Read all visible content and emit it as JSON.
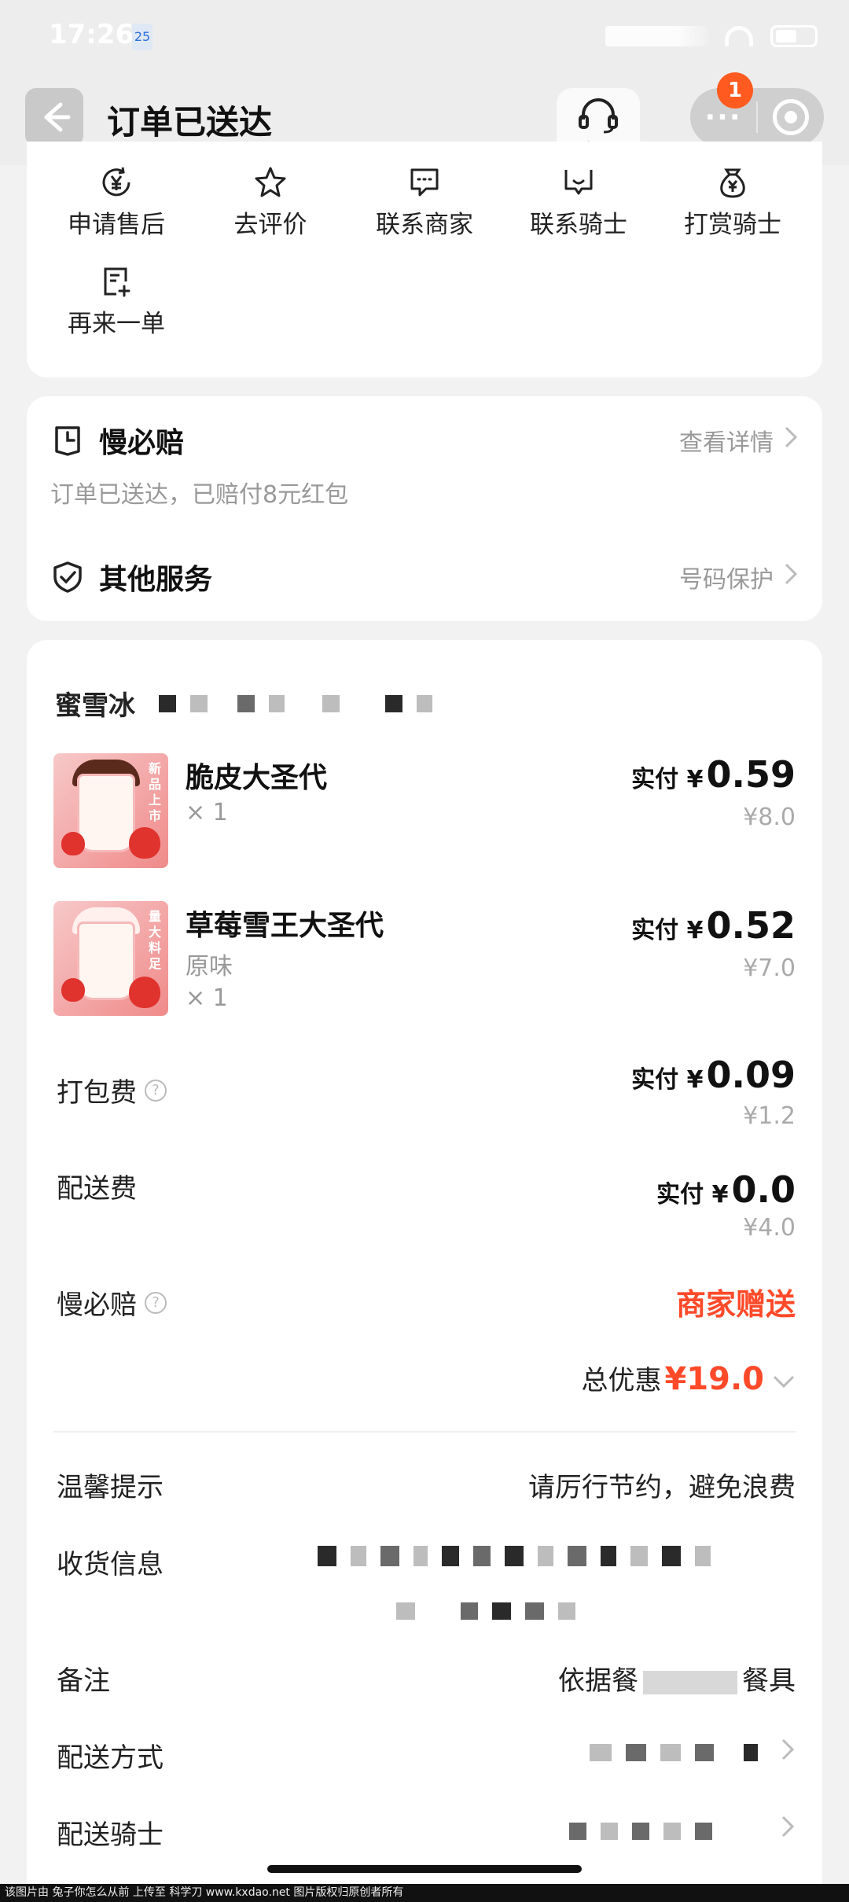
{
  "status_bar": {
    "time": "17:26",
    "badge": "25"
  },
  "header": {
    "title": "订单已送达",
    "customer_service_label": "客服",
    "more_label": "···",
    "notification_count": "1"
  },
  "actions": [
    {
      "label": "申请售后",
      "icon": "refund-icon"
    },
    {
      "label": "去评价",
      "icon": "star-icon"
    },
    {
      "label": "联系商家",
      "icon": "chat-icon"
    },
    {
      "label": "联系骑士",
      "icon": "rider-chat-icon"
    },
    {
      "label": "打赏骑士",
      "icon": "money-bag-icon"
    },
    {
      "label": "再来一单",
      "icon": "reorder-icon"
    }
  ],
  "services": {
    "compensation": {
      "title": "慢必赔",
      "link": "查看详情",
      "subtitle": "订单已送达，已赔付8元红包"
    },
    "other": {
      "title": "其他服务",
      "link": "号码保护"
    }
  },
  "order": {
    "store_name": "蜜雪冰",
    "items": [
      {
        "name": "脆皮大圣代",
        "spec": "",
        "qty": "× 1",
        "paid_prefix": "实付 ¥",
        "paid": "0.59",
        "original": "¥8.0",
        "tag": "新品上市"
      },
      {
        "name": "草莓雪王大圣代",
        "spec": "原味",
        "qty": "× 1",
        "paid_prefix": "实付 ¥",
        "paid": "0.52",
        "original": "¥7.0",
        "tag": "量大料足"
      }
    ],
    "packing": {
      "label": "打包费",
      "paid_prefix": "实付 ¥",
      "paid": "0.09",
      "original": "¥1.2"
    },
    "delivery": {
      "label": "配送费",
      "paid_prefix": "实付 ¥",
      "paid": "0.0",
      "original": "¥4.0"
    },
    "slow_comp": {
      "label": "慢必赔",
      "value": "商家赠送"
    },
    "total": {
      "label": "总优惠",
      "amount": "¥19.0"
    }
  },
  "info": {
    "tip": {
      "label": "温馨提示",
      "value": "请厉行节约，避免浪费"
    },
    "address": {
      "label": "收货信息"
    },
    "remark": {
      "label": "备注",
      "value_start": "依据餐",
      "value_end": "餐具"
    },
    "method": {
      "label": "配送方式"
    },
    "rider": {
      "label": "配送骑士"
    }
  },
  "footer": {
    "text": "该图片由 兔子你怎么从前 上传至 科学刀 www.kxdao.net 图片版权归原创者所有"
  },
  "colors": {
    "accent": "#ff4a2a",
    "badge": "#ff5a1f",
    "muted": "#999999"
  }
}
